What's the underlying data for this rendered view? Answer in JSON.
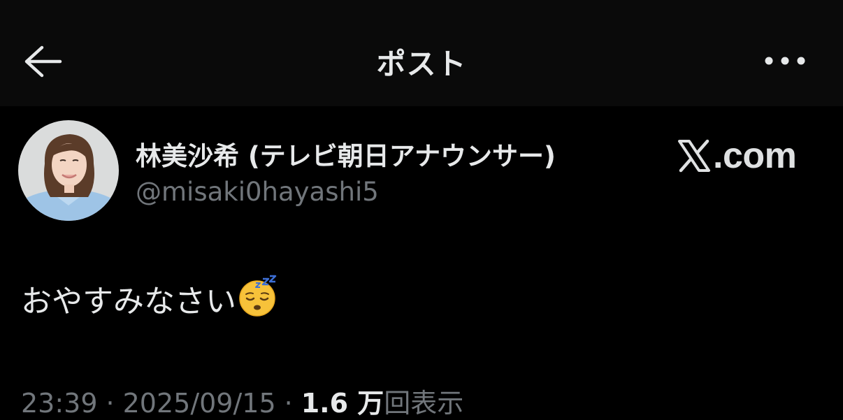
{
  "topbar": {
    "title": "ポスト",
    "back_icon": "arrow-left-icon",
    "more_icon": "more-horizontal-icon"
  },
  "author": {
    "display_name": "林美沙希 (テレビ朝日アナウンサー)",
    "handle": "@misaki0hayashi5"
  },
  "brand": {
    "logo_icon": "x-logo-icon",
    "text": ".com"
  },
  "post": {
    "text": "おやすみなさい",
    "emoji_icon": "sleeping-face-emoji"
  },
  "meta": {
    "time": "23:39",
    "separator": "·",
    "date": "2025/09/15",
    "views_count": "1.6 万",
    "views_label": "回表示"
  },
  "colors": {
    "background": "#000000",
    "topbar_background": "#0a0a0a",
    "primary_text": "#e7e9ea",
    "secondary_text": "#71767b"
  }
}
